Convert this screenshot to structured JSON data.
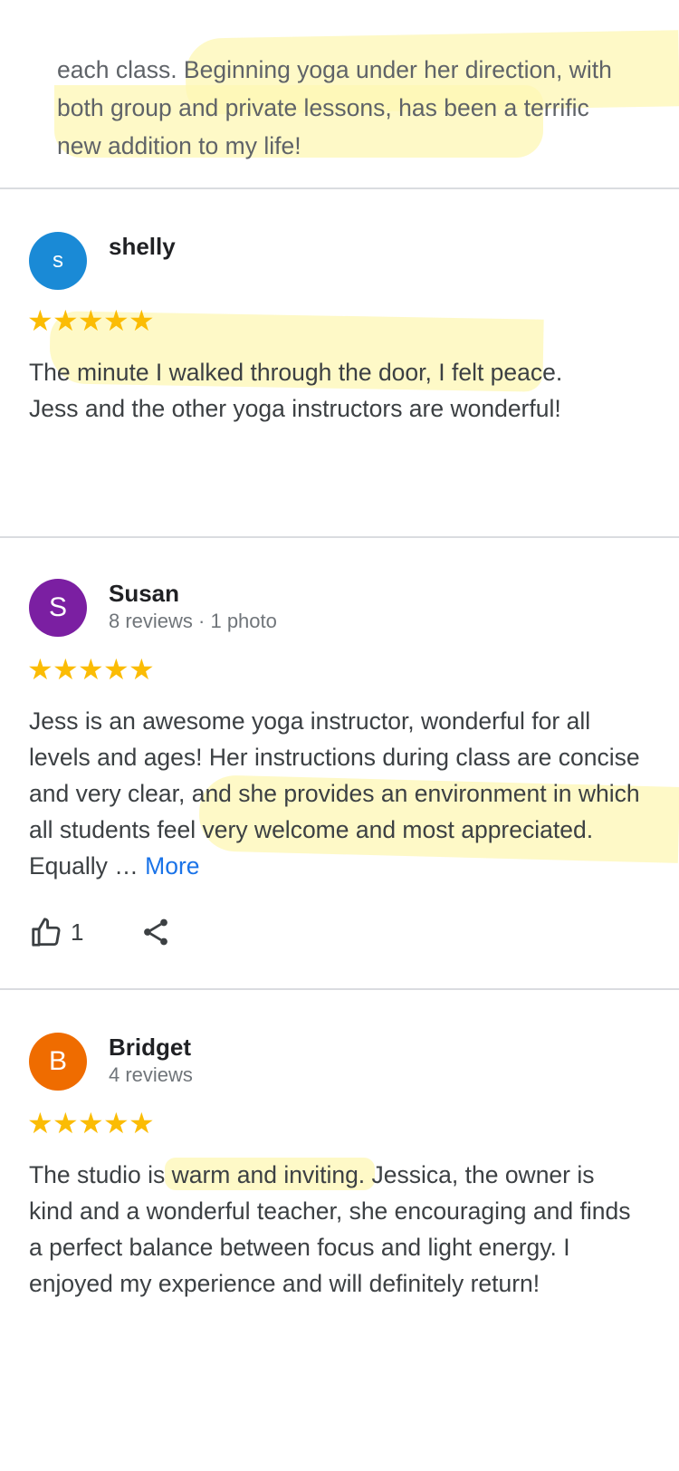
{
  "top_quote": {
    "text": "each class. Beginning yoga under her direction, with both group and private lessons, has been a terrific new addition to my life!"
  },
  "reviews": [
    {
      "name": "shelly",
      "avatar_letter": "s",
      "avatar_color": "#1a8ad6",
      "meta": "",
      "stars": [
        "★",
        "★",
        "★",
        "★",
        "★"
      ],
      "text": "The minute I walked through the door, I felt peace. Jess and the other yoga instructors are wonderful!"
    },
    {
      "name": "Susan",
      "avatar_letter": "S",
      "avatar_color": "#7b1fa2",
      "meta": "8 reviews · 1 photo",
      "stars": [
        "★",
        "★",
        "★",
        "★",
        "★"
      ],
      "text": "Jess is an awesome yoga instructor, wonderful for all levels and ages! Her instructions during class are concise and very clear, and she provides an environment in which all students feel very welcome and most appreciated. Equally … ",
      "more_label": "More",
      "like_count": "1"
    },
    {
      "name": "Bridget",
      "avatar_letter": "B",
      "avatar_color": "#ef6c00",
      "meta": "4 reviews",
      "stars": [
        "★",
        "★",
        "★",
        "★",
        "★"
      ],
      "text": "The studio is warm and inviting. Jessica, the owner is kind and a wonderful teacher, she encouraging and finds a perfect balance between focus and light energy. I enjoyed my experience and will definitely return!"
    }
  ],
  "icons": {
    "like": "thumbs-up-icon",
    "share": "share-icon",
    "star": "star-icon"
  },
  "colors": {
    "star": "#fbbc04",
    "link": "#1a73e8",
    "highlight": "#fdf7b4"
  }
}
